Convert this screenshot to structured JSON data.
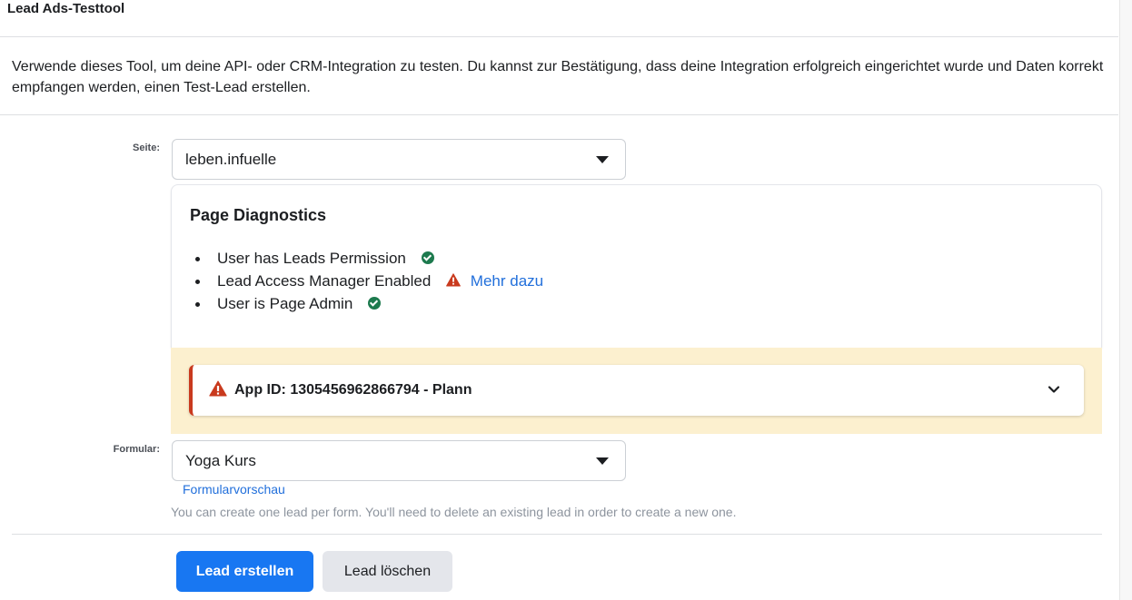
{
  "header": {
    "title": "Lead Ads-Testtool"
  },
  "description": "Verwende dieses Tool, um deine API- oder CRM-Integration zu testen. Du kannst zur Bestätigung, dass deine Integration erfolgreich eingerichtet wurde und Daten korrekt empfangen werden, einen Test-Lead erstellen.",
  "page_field": {
    "label": "Seite:",
    "value": "leben.infuelle"
  },
  "diagnostics": {
    "title": "Page Diagnostics",
    "items": [
      {
        "label": "User has Leads Permission",
        "status": "check-icon"
      },
      {
        "label": "Lead Access Manager Enabled",
        "status": "warning-icon",
        "link": "Mehr dazu"
      },
      {
        "label": "User is Page Admin",
        "status": "check-icon"
      }
    ],
    "check_color": "#1d7a4e",
    "warning_color": "#c93a1e"
  },
  "app_warning": {
    "text": "App ID: 1305456962866794 - Plann",
    "icon": "warning-icon",
    "expand_icon": "chevron-down-icon",
    "background": "#fcf0cf"
  },
  "form_field": {
    "label": "Formular:",
    "value": "Yoga Kurs",
    "preview_link": "Formularvorschau"
  },
  "note": "You can create one lead per form. You'll need to delete an existing lead in order to create a new one.",
  "buttons": {
    "create": "Lead erstellen",
    "delete": "Lead löschen"
  },
  "colors": {
    "primary": "#1877f2",
    "link": "#216fdb"
  }
}
